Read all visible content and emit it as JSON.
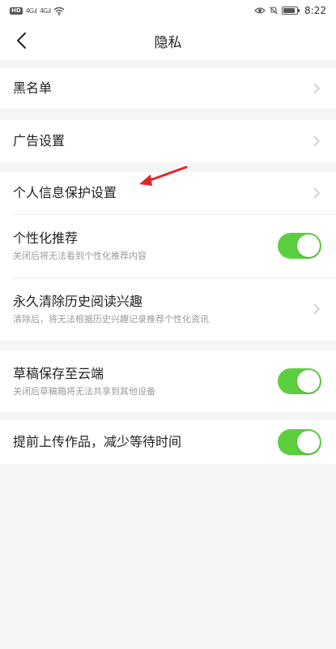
{
  "status_bar": {
    "hd_badge": "HD",
    "signal_1": "4G.ıl",
    "signal_2": "4G.ıl",
    "time": "8:22"
  },
  "header": {
    "title": "隐私",
    "back_icon": "chevron-left-icon"
  },
  "sections": {
    "blacklist": {
      "label": "黑名单"
    },
    "ads": {
      "label": "广告设置"
    },
    "personal": {
      "info_protection": {
        "label": "个人信息保护设置"
      },
      "personalized_rec": {
        "label": "个性化推荐",
        "desc": "关闭后将无法看到个性化推荐内容",
        "enabled": true
      },
      "clear_history": {
        "label": "永久清除历史阅读兴趣",
        "desc": "清除后，将无法根据历史兴趣记录推荐个性化资讯"
      }
    },
    "drafts": {
      "label": "草稿保存至云端",
      "desc": "关闭后草稿箱将无法共享到其他设备",
      "enabled": true
    },
    "upload": {
      "label": "提前上传作品，减少等待时间",
      "enabled": true
    }
  },
  "colors": {
    "toggle_on": "#5ccf3e",
    "annotation_arrow": "#e0252b",
    "background": "#f5f5f5"
  }
}
